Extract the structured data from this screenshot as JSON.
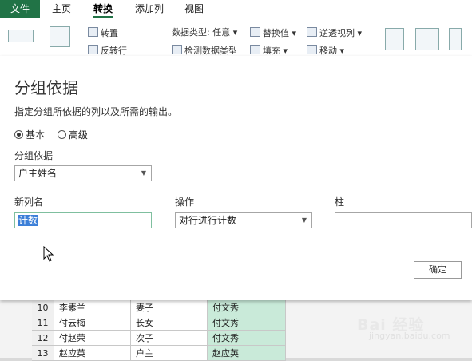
{
  "tabs": [
    "文件",
    "主页",
    "转换",
    "添加列",
    "视图"
  ],
  "ribbon": {
    "transpose": "转置",
    "reverse_rows": "反转行",
    "data_type": "数据类型: 任意",
    "detect_type": "检测数据类型",
    "replace_values": "替换值",
    "fill": "填充",
    "unpivot": "逆透视列",
    "move": "移动"
  },
  "dialog": {
    "title": "分组依据",
    "subtitle": "指定分组所依据的列以及所需的输出。",
    "radio_basic": "基本",
    "radio_advanced": "高级",
    "group_by_label": "分组依据",
    "group_by_value": "户主姓名",
    "new_col_label": "新列名",
    "new_col_value": "计数",
    "operation_label": "操作",
    "operation_value": "对行进行计数",
    "column_label": "柱",
    "column_value": "",
    "ok": "确定"
  },
  "table_rows": [
    {
      "num": "10",
      "a": "李素兰",
      "b": "妻子",
      "c": "付文秀"
    },
    {
      "num": "11",
      "a": "付云梅",
      "b": "长女",
      "c": "付文秀"
    },
    {
      "num": "12",
      "a": "付赵荣",
      "b": "次子",
      "c": "付文秀"
    },
    {
      "num": "13",
      "a": "赵应英",
      "b": "户主",
      "c": "赵应英"
    }
  ],
  "watermark": {
    "main": "Bai 经验",
    "sub": "jingyan.baidu.com"
  }
}
